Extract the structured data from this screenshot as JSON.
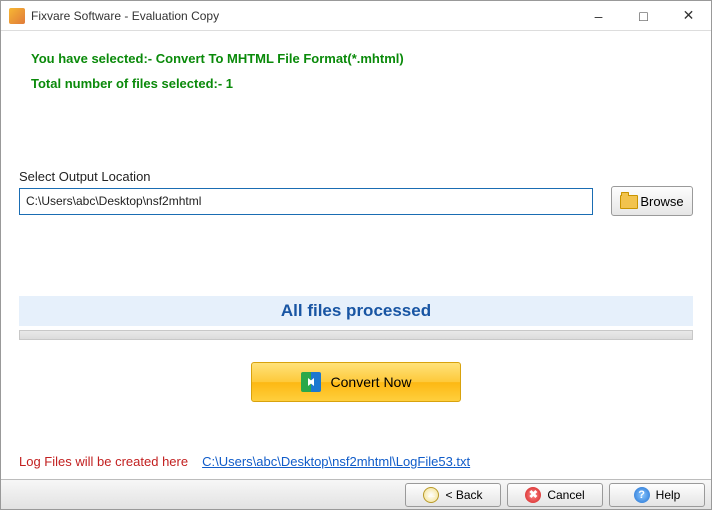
{
  "window": {
    "title": "Fixvare Software - Evaluation Copy"
  },
  "info": {
    "line1": "You have selected:- Convert To MHTML File Format(*.mhtml)",
    "line2": "Total number of files selected:- 1"
  },
  "output": {
    "label": "Select Output Location",
    "value": "C:\\Users\\abc\\Desktop\\nsf2mhtml",
    "browse": "Browse"
  },
  "status": {
    "text": "All files processed"
  },
  "convert": {
    "label": "Convert Now"
  },
  "log": {
    "label": "Log Files will be created here",
    "path": "C:\\Users\\abc\\Desktop\\nsf2mhtml\\LogFile53.txt"
  },
  "footer": {
    "back": "< Back",
    "cancel": "Cancel",
    "help": "Help"
  }
}
